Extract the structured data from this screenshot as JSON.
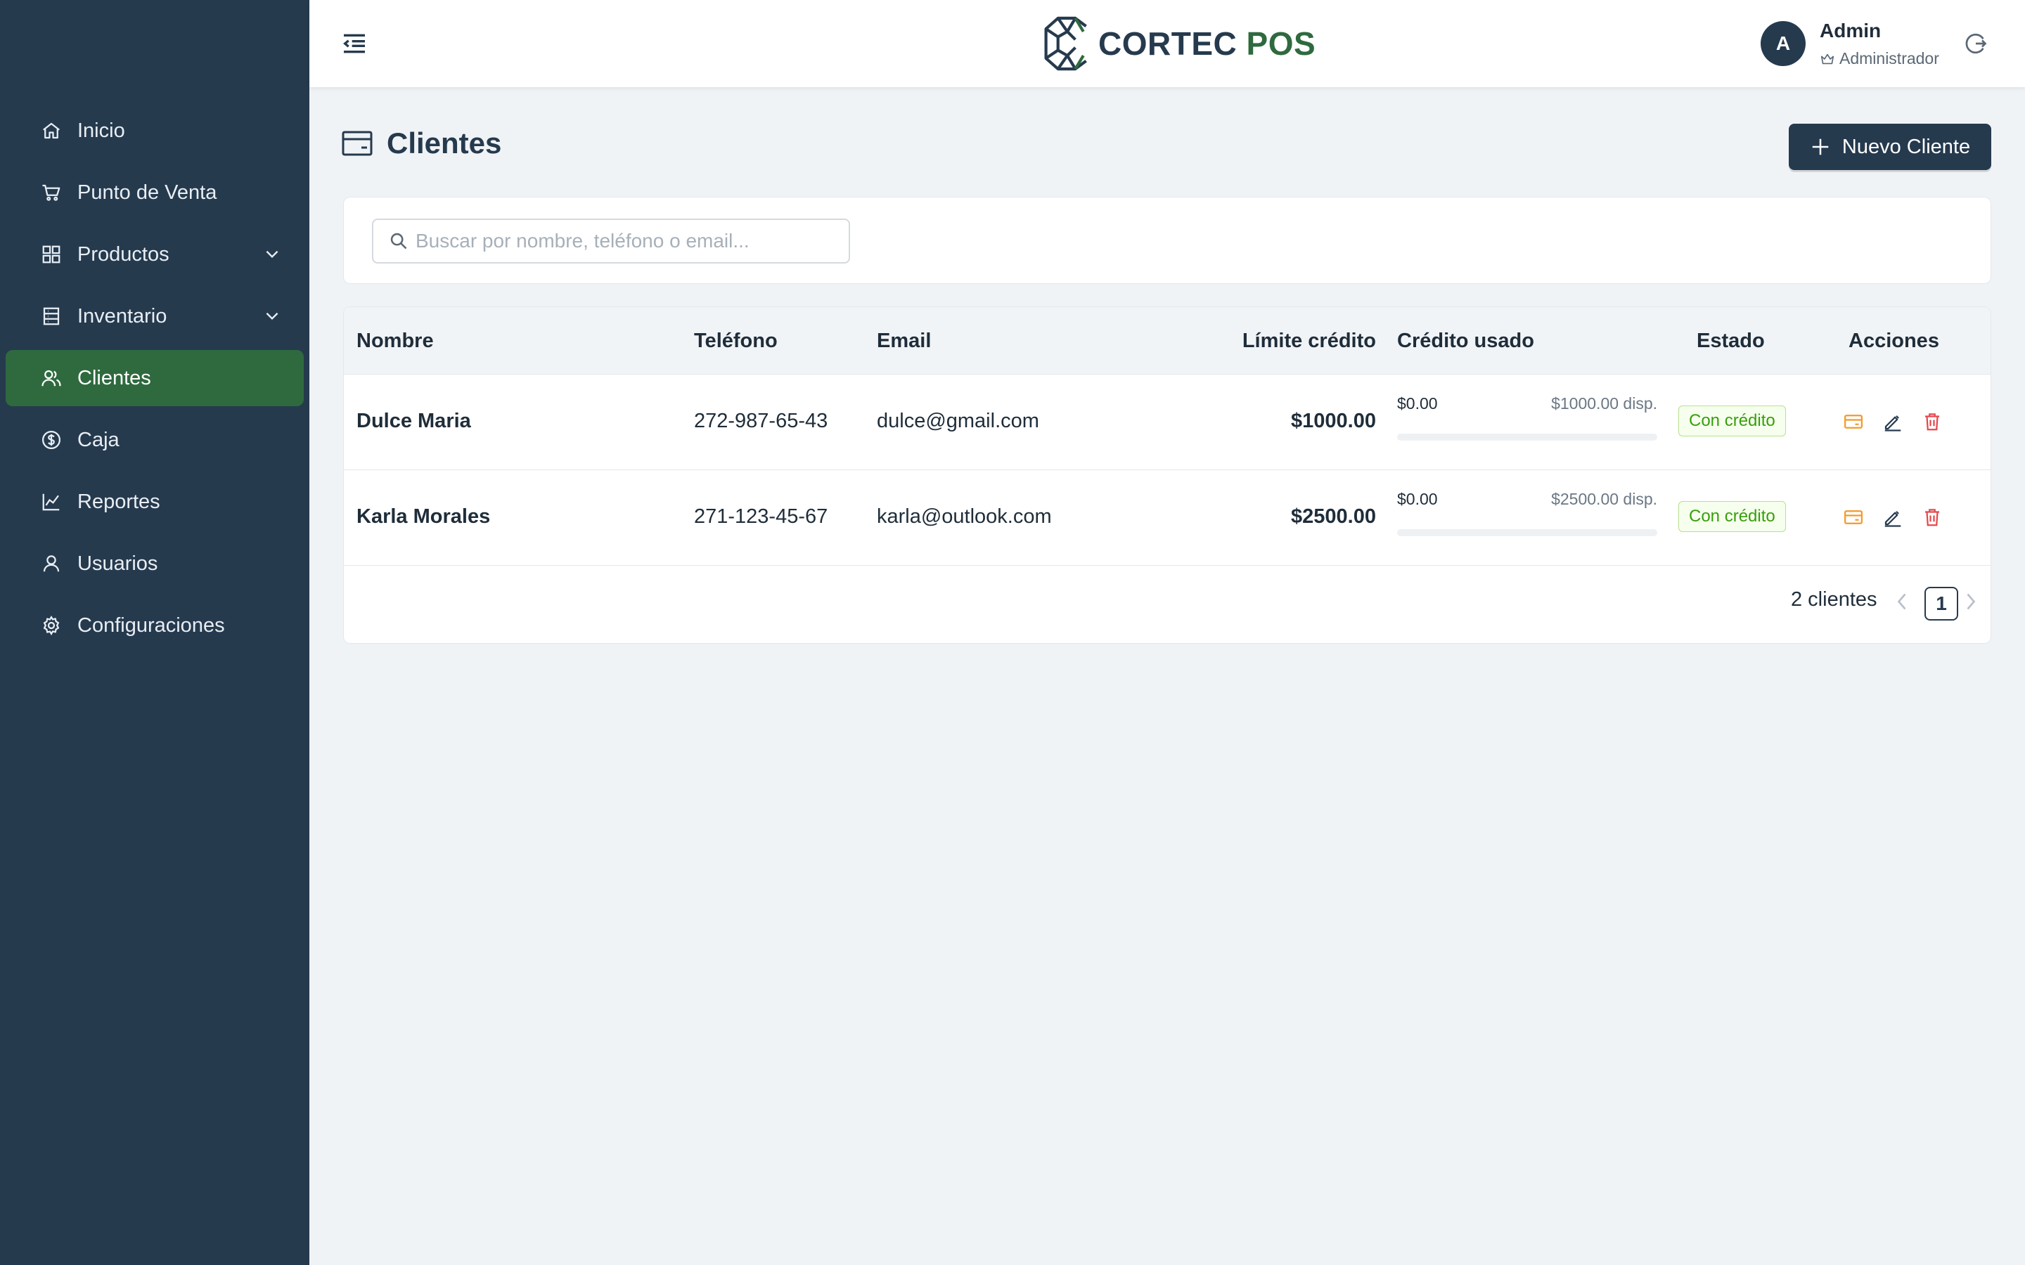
{
  "sidebar": {
    "items": [
      {
        "label": "Inicio",
        "icon": "home-icon"
      },
      {
        "label": "Punto de Venta",
        "icon": "cart-icon"
      },
      {
        "label": "Productos",
        "icon": "grid-icon",
        "expandable": true
      },
      {
        "label": "Inventario",
        "icon": "database-icon",
        "expandable": true
      },
      {
        "label": "Clientes",
        "icon": "users-icon",
        "active": true
      },
      {
        "label": "Caja",
        "icon": "dollar-circle-icon"
      },
      {
        "label": "Reportes",
        "icon": "line-chart-icon"
      },
      {
        "label": "Usuarios",
        "icon": "user-icon"
      },
      {
        "label": "Configuraciones",
        "icon": "gear-icon"
      }
    ]
  },
  "header": {
    "brand_part1": "CORTEC",
    "brand_part2": "POS",
    "user": {
      "initial": "A",
      "name": "Admin",
      "role": "Administrador"
    }
  },
  "page": {
    "title": "Clientes",
    "new_button_label": "Nuevo Cliente"
  },
  "search": {
    "placeholder": "Buscar por nombre, teléfono o email...",
    "value": ""
  },
  "table": {
    "columns": [
      "Nombre",
      "Teléfono",
      "Email",
      "Límite crédito",
      "Crédito usado",
      "Estado",
      "Acciones"
    ],
    "rows": [
      {
        "name": "Dulce Maria",
        "phone": "272-987-65-43",
        "email": "dulce@gmail.com",
        "limit": "$1000.00",
        "used": "$0.00",
        "available": "$1000.00 disp.",
        "used_fraction": 0,
        "status": "Con crédito"
      },
      {
        "name": "Karla Morales",
        "phone": "271-123-45-67",
        "email": "karla@outlook.com",
        "limit": "$2500.00",
        "used": "$0.00",
        "available": "$2500.00 disp.",
        "used_fraction": 0,
        "status": "Con crédito"
      }
    ]
  },
  "pagination": {
    "count_label": "2 clientes",
    "current_page": "1"
  },
  "colors": {
    "sidebar_bg": "#263a4e",
    "active_item": "#2e6a3e",
    "brand_dark": "#263a4e",
    "brand_green": "#2e6a3e",
    "status_green": "#389e0d",
    "credit_icon": "#f29a2e",
    "delete_icon": "#e5484d"
  }
}
